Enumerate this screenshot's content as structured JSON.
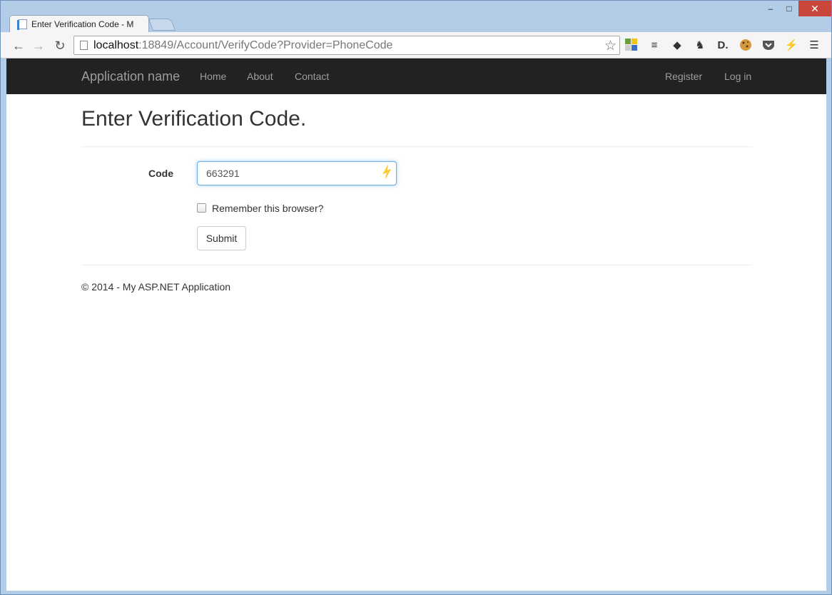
{
  "browser": {
    "tab_title": "Enter Verification Code - M",
    "tab_close": "×",
    "url_host": "localhost",
    "url_rest": ":18849/Account/VerifyCode?Provider=PhoneCode",
    "window_controls": {
      "minimize": "‒",
      "maximize": "□",
      "close": "✕"
    }
  },
  "navbar": {
    "brand": "Application name",
    "links": [
      "Home",
      "About",
      "Contact"
    ],
    "right_links": [
      "Register",
      "Log in"
    ]
  },
  "main": {
    "title": "Enter Verification Code.",
    "code_label": "Code",
    "code_value": "663291",
    "remember_label": "Remember this browser?",
    "remember_checked": false,
    "submit_label": "Submit"
  },
  "footer": {
    "text": "© 2014 - My ASP.NET Application"
  },
  "colors": {
    "navbar_bg": "#222222",
    "nav_text": "#9d9d9d",
    "focus_border": "#66afe9",
    "close_red": "#c9463d"
  }
}
